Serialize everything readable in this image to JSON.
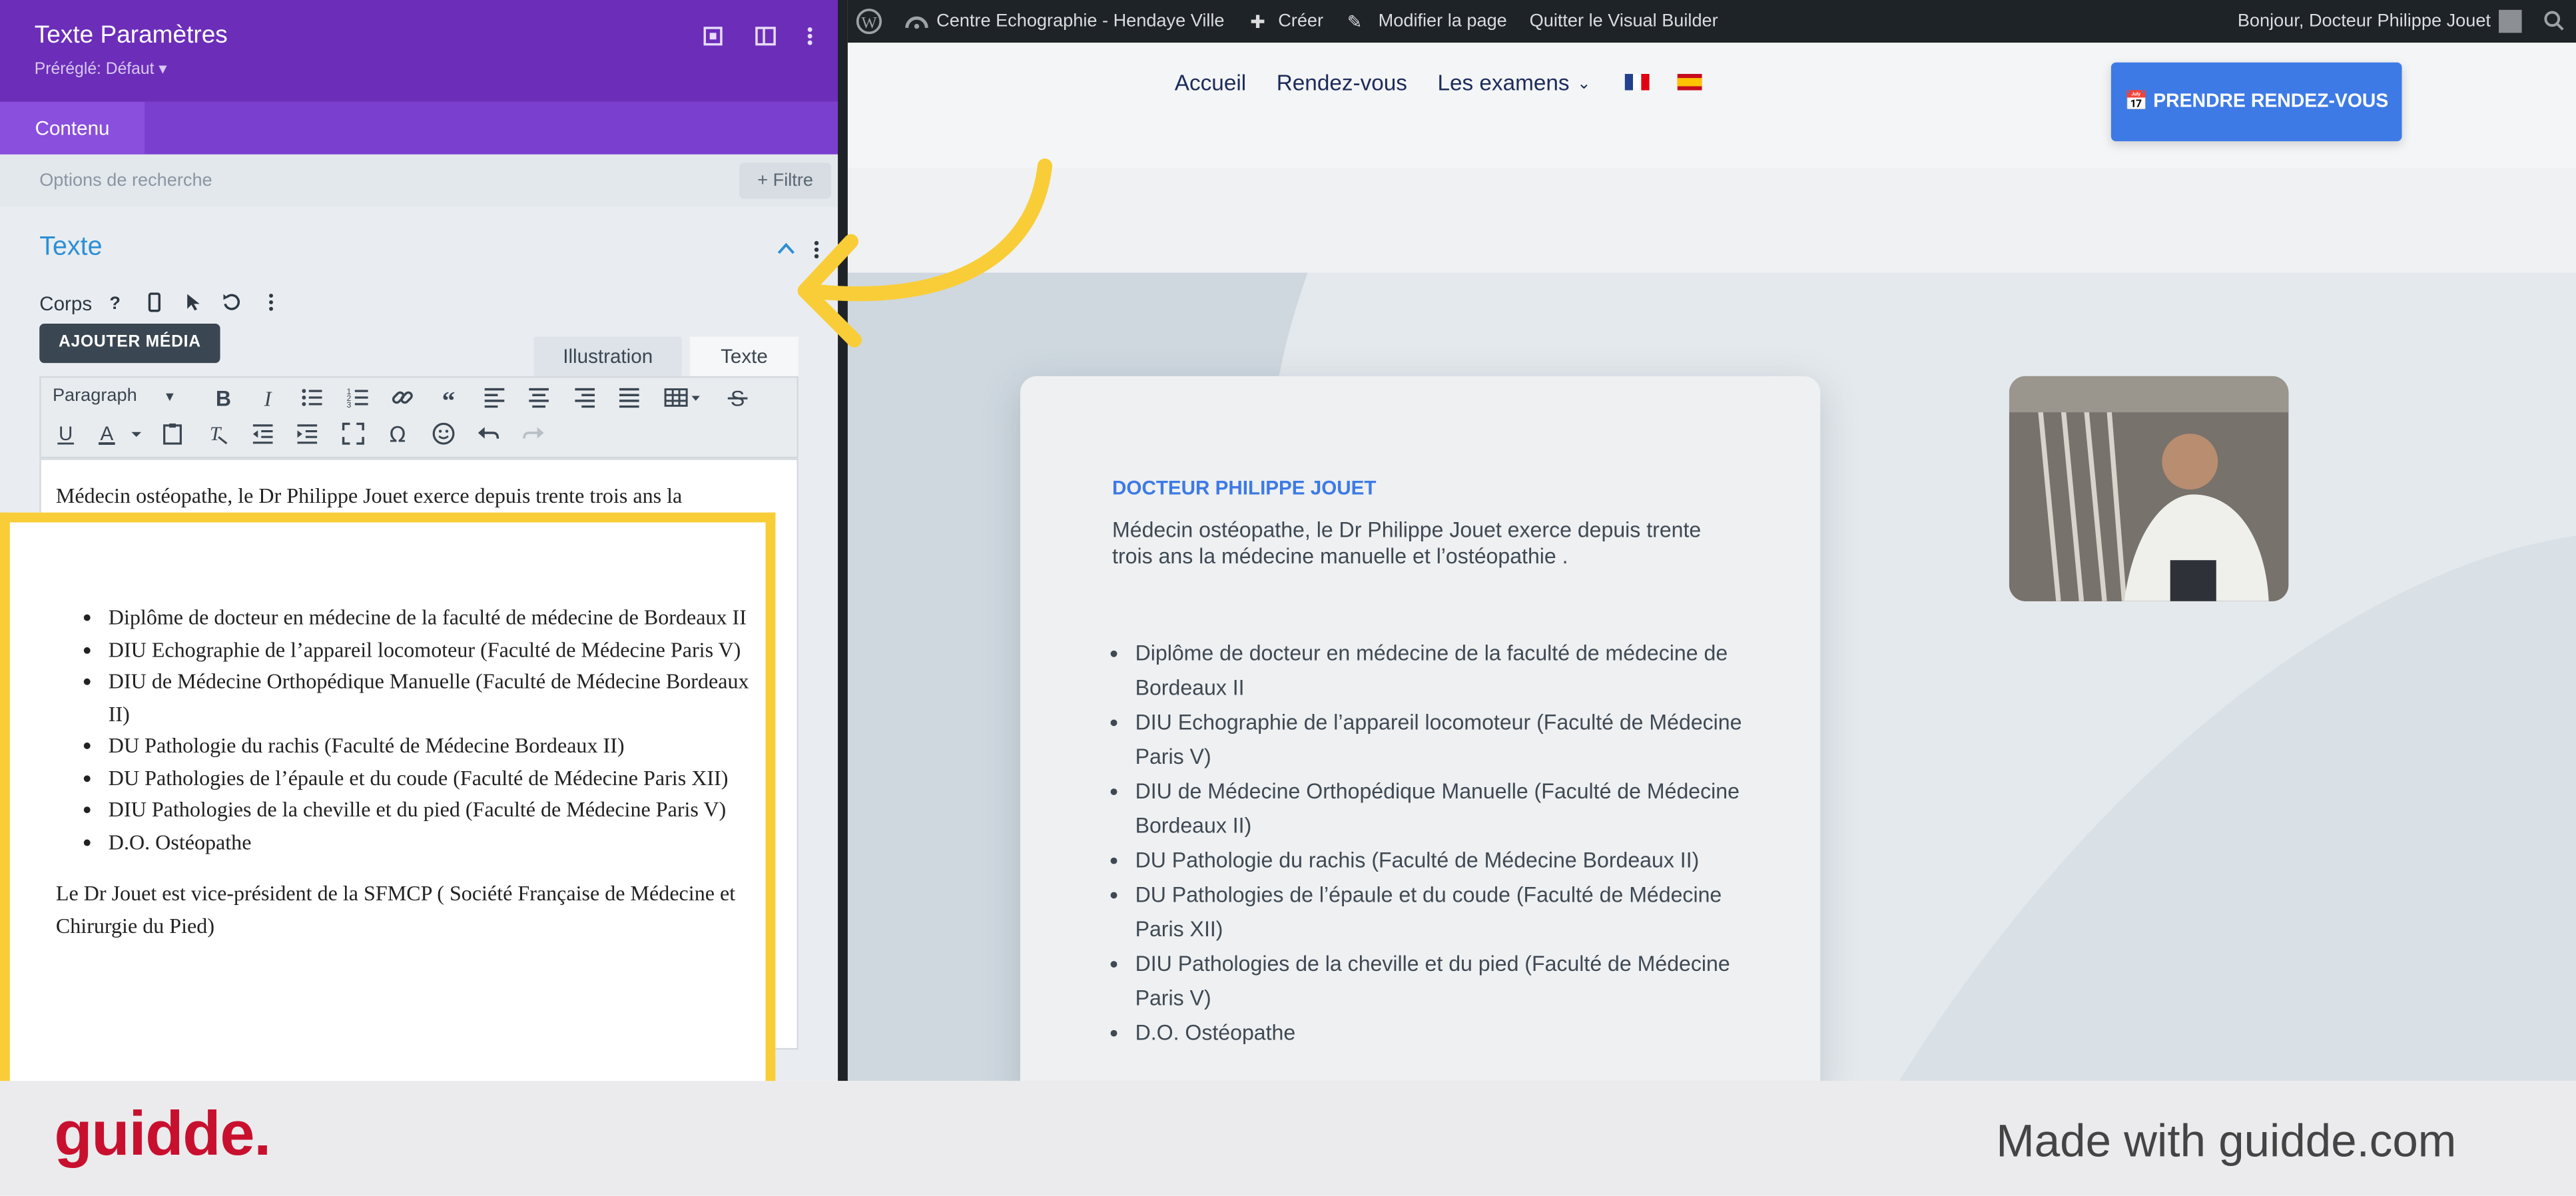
{
  "builder": {
    "panel_title": "Texte Paramètres",
    "preset": "Préréglé: Défaut ▾",
    "tab_content": "Contenu",
    "search_placeholder": "Options de recherche",
    "filter_label": "+ Filtre",
    "section_title": "Texte",
    "body_label": "Corps",
    "add_media_label": "AJOUTER MÉDIA",
    "tab_illustration": "Illustration",
    "tab_text": "Texte",
    "paragraph_select": "Paragraph"
  },
  "editor": {
    "intro": "Médecin ostéopathe, le Dr Philippe Jouet exerce depuis trente trois ans la médecine manuelle et l’ostéopathie .",
    "items": [
      "Diplôme de docteur en médecine de la faculté de médecine de Bordeaux II",
      "DIU Echographie de l’appareil locomoteur (Faculté de Médecine Paris V)",
      "DIU de Médecine Orthopédique Manuelle (Faculté de Médecine Bordeaux II)",
      "DU Pathologie du rachis (Faculté de Médecine Bordeaux II)",
      "DU Pathologies de l’épaule et du coude (Faculté de Médecine Paris XII)",
      "DIU Pathologies de la cheville et du pied (Faculté de Médecine Paris V)",
      "D.O. Ostéopathe"
    ],
    "closing": "Le Dr Jouet est vice-président de la SFMCP ( Société Française de Médecine et Chirurgie du Pied)"
  },
  "adminbar": {
    "site_name": "Centre Echographie - Hendaye Ville",
    "create": "Créer",
    "edit_page": "Modifier la page",
    "quit_builder": "Quitter le Visual Builder",
    "greeting": "Bonjour, Docteur Philippe Jouet"
  },
  "site": {
    "nav": [
      "Accueil",
      "Rendez-vous",
      "Les examens"
    ],
    "cta": "PRENDRE RENDEZ-VOUS",
    "card_title": "DOCTEUR PHILIPPE JOUET",
    "card_intro": "Médecin ostéopathe, le Dr Philippe Jouet exerce depuis trente trois ans la médecine manuelle et l’ostéopathie .",
    "card_items": [
      "Diplôme de docteur en médecine de la faculté de médecine de Bordeaux II",
      "DIU Echographie de l’appareil locomoteur (Faculté de Médecine Paris V)",
      "DIU de Médecine Orthopédique Manuelle (Faculté de Médecine Bordeaux II)",
      "DU Pathologie du rachis (Faculté de Médecine Bordeaux II)",
      "DU Pathologies de l’épaule et du coude (Faculté de Médecine Paris XII)",
      "DIU Pathologies de la cheville et du pied (Faculté de Médecine Paris V)",
      "D.O. Ostéopathe"
    ]
  },
  "footer": {
    "logo": "guidde.",
    "made_with": "Made with guidde.com"
  },
  "colors": {
    "builder_purple": "#6c2eb9",
    "accent_blue": "#3d7ae5",
    "highlight_yellow": "#f9cd38",
    "guidde_red": "#c8102e"
  }
}
